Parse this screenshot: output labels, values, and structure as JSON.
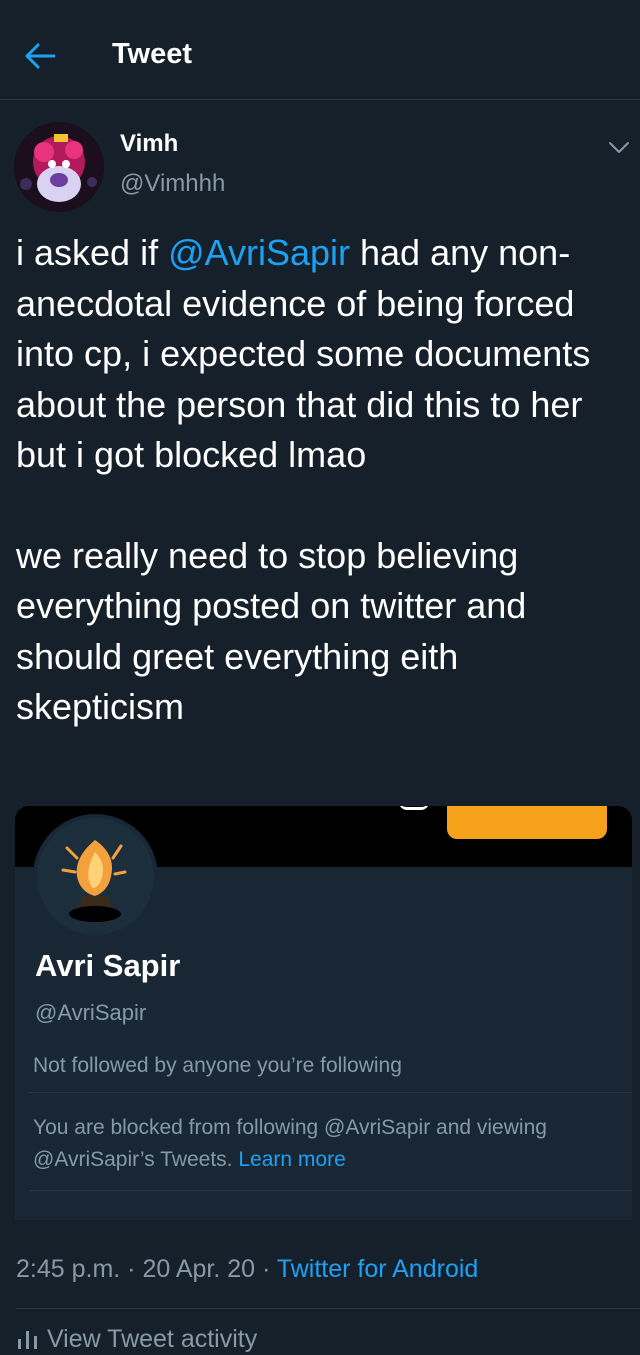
{
  "header": {
    "title": "Tweet"
  },
  "author": {
    "name": "Vimh",
    "handle": "@Vimhhh"
  },
  "tweet": {
    "p1_pre": "i asked if ",
    "p1_mention": "@AvriSapir",
    "p1_post": " had any non-anecdotal evidence of being forced into cp, i expected some documents about the person that did this to her but i got blocked lmao",
    "p2": "we really need to stop believing everything posted on twitter and should greet everything eith skepticism"
  },
  "card": {
    "name": "Avri Sapir",
    "handle": "@AvriSapir",
    "follow_status": "Not followed by anyone you’re following",
    "blocked_text": "You are blocked from following @AvriSapir and viewing @AvriSapir’s Tweets. ",
    "learn_more": "Learn more"
  },
  "meta": {
    "time": "2:45 p.m.",
    "date": "20 Apr. 20",
    "sep": " · ",
    "source": "Twitter for Android"
  },
  "activity": {
    "label": "View Tweet activity"
  },
  "colors": {
    "background": "#15202b",
    "accent": "#1da1f2",
    "muted": "#8899a6",
    "banner_button": "#f7a21b"
  }
}
